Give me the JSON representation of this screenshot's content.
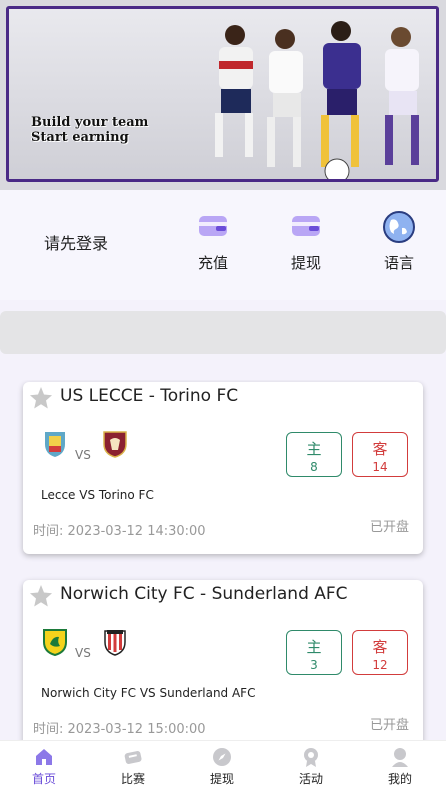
{
  "banner": {
    "line1": "Build your team",
    "line2": "Start earning"
  },
  "account": {
    "login_prompt": "请先登录",
    "recharge_label": "充值",
    "withdraw_label": "提现",
    "language_label": "语言"
  },
  "matches": [
    {
      "title": "US LECCE - Torino FC",
      "vs": "VS",
      "home_label": "主",
      "home_value": "8",
      "away_label": "客",
      "away_value": "14",
      "teams": "Lecce VS Torino FC",
      "time": "时间:  2023-03-12 14:30:00",
      "status": "已开盘"
    },
    {
      "title": "Norwich City FC - Sunderland AFC",
      "vs": "VS",
      "home_label": "主",
      "home_value": "3",
      "away_label": "客",
      "away_value": "12",
      "teams": "Norwich City FC VS Sunderland AFC",
      "time": "时间:  2023-03-12 15:00:00",
      "status": "已开盘"
    }
  ],
  "tabs": {
    "home": "首页",
    "matches": "比赛",
    "withdraw": "提现",
    "activity": "活动",
    "mine": "我的"
  },
  "colors": {
    "accent": "#6a4cd8",
    "home_odds": "#2f8a6a",
    "away_odds": "#d23c3c"
  }
}
